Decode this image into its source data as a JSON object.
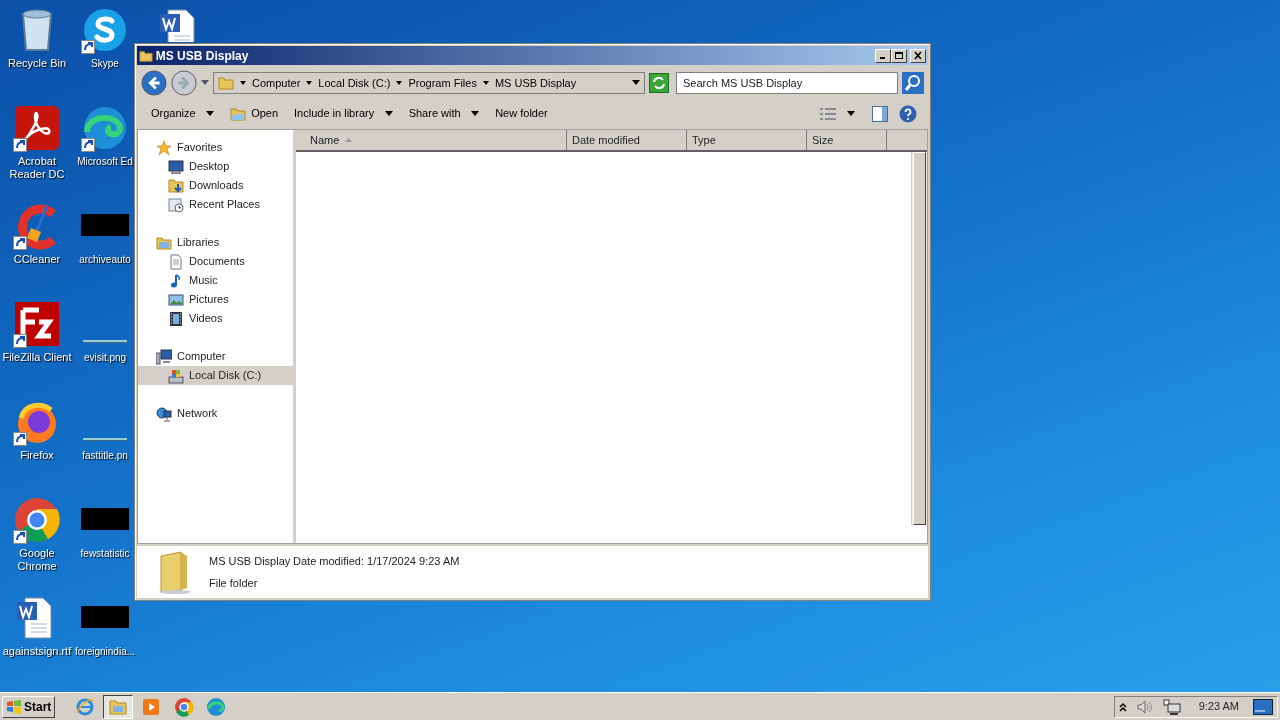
{
  "desktop": {
    "columns": [
      [
        {
          "label": "Recycle Bin",
          "kind": "recycle",
          "shortcut": false
        },
        {
          "label": "Acrobat Reader DC",
          "kind": "acrobat",
          "shortcut": true
        },
        {
          "label": "CCleaner",
          "kind": "ccleaner",
          "shortcut": true
        },
        {
          "label": "FileZilla Client",
          "kind": "filezilla",
          "shortcut": true
        },
        {
          "label": "Firefox",
          "kind": "firefox",
          "shortcut": true
        },
        {
          "label": "Google Chrome",
          "kind": "chrome",
          "shortcut": true
        },
        {
          "label": "againstsign.rtf",
          "kind": "word",
          "shortcut": false
        }
      ],
      [
        {
          "label": "Skype",
          "kind": "skype",
          "shortcut": true
        },
        {
          "label": "Microsoft Ed",
          "kind": "edge",
          "shortcut": true
        },
        {
          "label": "archiveauto",
          "kind": "redacted",
          "shortcut": false
        },
        {
          "label": "evisit.png",
          "kind": "image",
          "shortcut": false
        },
        {
          "label": "fasttitle.pn",
          "kind": "image",
          "shortcut": false
        },
        {
          "label": "fewstatistic",
          "kind": "redacted",
          "shortcut": false
        },
        {
          "label": "foreignindia...",
          "kind": "redacted",
          "shortcut": false
        }
      ],
      [
        {
          "kind": "word",
          "shortcut": false
        }
      ]
    ]
  },
  "window": {
    "title": "MS USB Display",
    "nav": {
      "back_disabled": false,
      "forward_disabled": true
    },
    "breadcrumb": [
      "Computer",
      "Local Disk (C:)",
      "Program Files",
      "MS USB Display"
    ],
    "search": {
      "placeholder": "Search MS USB Display"
    },
    "toolbar": [
      {
        "label": "Organize",
        "kind": "menu"
      },
      {
        "label": "Open",
        "kind": "open"
      },
      {
        "label": "Include in library",
        "kind": "menu"
      },
      {
        "label": "Share with",
        "kind": "menu"
      },
      {
        "label": "New folder",
        "kind": "plain"
      }
    ],
    "sidebar": [
      {
        "label": "Favorites",
        "kind": "star",
        "children": [
          {
            "label": "Desktop",
            "kind": "desktop",
            "selected": false
          },
          {
            "label": "Downloads",
            "kind": "downloads",
            "selected": false
          },
          {
            "label": "Recent Places",
            "kind": "recent",
            "selected": false
          }
        ]
      },
      {
        "label": "Libraries",
        "kind": "library",
        "children": [
          {
            "label": "Documents",
            "kind": "documents",
            "selected": false
          },
          {
            "label": "Music",
            "kind": "music",
            "selected": false
          },
          {
            "label": "Pictures",
            "kind": "pictures",
            "selected": false
          },
          {
            "label": "Videos",
            "kind": "videos",
            "selected": false
          }
        ]
      },
      {
        "label": "Computer",
        "kind": "computer",
        "children": [
          {
            "label": "Local Disk (C:)",
            "kind": "disk",
            "selected": true
          }
        ]
      },
      {
        "label": "Network",
        "kind": "network"
      }
    ],
    "table": {
      "columns": [
        {
          "label": "Name",
          "sorted": true
        },
        {
          "label": "Date modified",
          "sorted": false
        },
        {
          "label": "Type",
          "sorted": false
        },
        {
          "label": "Size",
          "sorted": false
        }
      ]
    },
    "details": {
      "name": "MS USB Display",
      "date": "Date modified: 1/17/2024 9:23 AM",
      "type": "File folder"
    }
  },
  "taskbar": {
    "start": "Start",
    "apps": [
      {
        "kind": "ie",
        "active": false
      },
      {
        "kind": "explorer",
        "active": true
      },
      {
        "kind": "media",
        "active": false
      },
      {
        "kind": "chrome",
        "active": false
      },
      {
        "kind": "edge",
        "active": false
      }
    ],
    "tray": {
      "time": "9:23 AM"
    }
  }
}
